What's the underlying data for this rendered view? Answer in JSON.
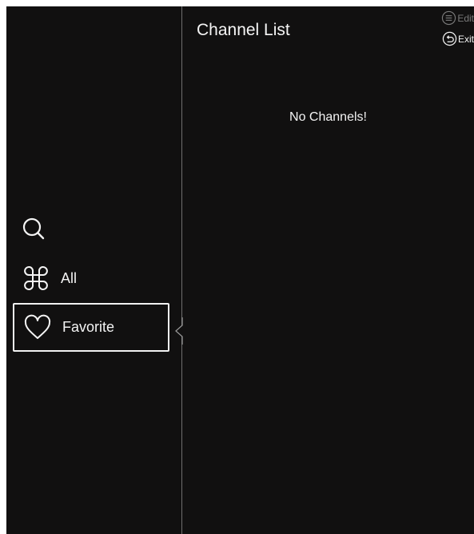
{
  "header": {
    "title": "Channel List"
  },
  "hints": {
    "edit_label": "Edit",
    "exit_label": "Exit"
  },
  "main": {
    "empty_message": "No Channels!"
  },
  "sidebar": {
    "items": [
      {
        "icon": "search-icon",
        "label": ""
      },
      {
        "icon": "command-icon",
        "label": "All"
      },
      {
        "icon": "heart-icon",
        "label": "Favorite",
        "selected": true
      }
    ]
  },
  "colors": {
    "background": "#111010",
    "text": "#f4f4f4",
    "divider": "#6f6f6f",
    "muted": "#7a7a7a",
    "focus_border": "#f2f2f2"
  }
}
